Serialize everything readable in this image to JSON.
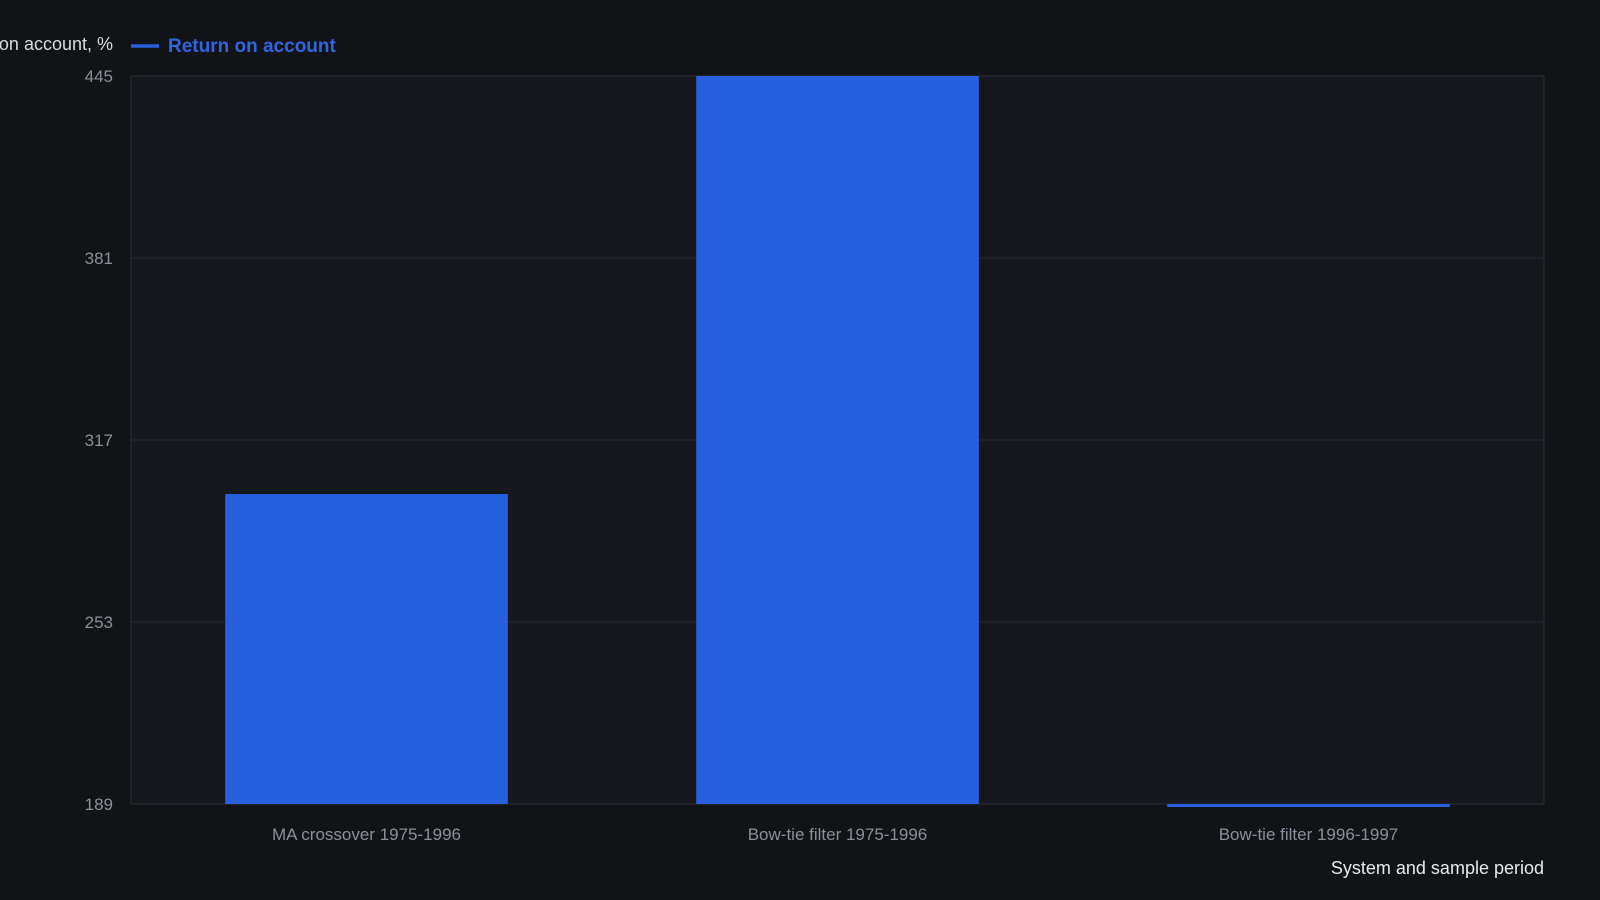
{
  "colors": {
    "background": "#111317",
    "plot_background": "#16181d",
    "grid": "#262a31",
    "bar": "#2760df",
    "legend_text": "#2f66e0",
    "tick_text": "#8a9099",
    "axis_label_text": "#d7dbe0"
  },
  "chart_data": {
    "type": "bar",
    "categories": [
      "MA crossover 1975-1996",
      "Bow-tie filter 1975-1996",
      "Bow-tie filter 1996-1997"
    ],
    "series": [
      {
        "name": "Return on account",
        "values": [
          298,
          445,
          188.5
        ]
      }
    ],
    "ylabel": "Return on account, %",
    "xlabel": "System and sample period",
    "ylim": [
      189,
      445
    ],
    "yticks": [
      "189",
      "253",
      "317",
      "381",
      "445"
    ],
    "grid": true,
    "legend_position": "top-left"
  }
}
